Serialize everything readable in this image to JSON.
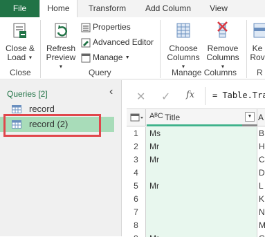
{
  "tabs": [
    {
      "label": "File"
    },
    {
      "label": "Home"
    },
    {
      "label": "Transform"
    },
    {
      "label": "Add Column"
    },
    {
      "label": "View"
    }
  ],
  "ribbon": {
    "close_load": {
      "line1": "Close &",
      "line2": "Load"
    },
    "refresh_preview": {
      "line1": "Refresh",
      "line2": "Preview"
    },
    "properties": "Properties",
    "advanced_editor": "Advanced Editor",
    "manage": "Manage",
    "choose_columns": {
      "line1": "Choose",
      "line2": "Columns"
    },
    "remove_columns": {
      "line1": "Remove",
      "line2": "Columns"
    },
    "keep_rows": {
      "line1": "Ke",
      "line2": "Rov"
    },
    "groups": {
      "close": "Close",
      "query": "Query",
      "manage_columns": "Manage Columns",
      "next": "R"
    }
  },
  "queries": {
    "header": "Queries [2]",
    "collapse_glyph": "‹",
    "items": [
      {
        "label": "record"
      },
      {
        "label": "record (2)"
      }
    ]
  },
  "formula_bar": {
    "cancel": "✕",
    "confirm": "✓",
    "fx": "fx",
    "formula": "= Table.Tran"
  },
  "grid": {
    "column_type": "AᴮC",
    "column_name": "Title",
    "second_column_name": "A",
    "rows": [
      {
        "num": "1",
        "title": "Ms",
        "next": "B"
      },
      {
        "num": "2",
        "title": "Mr",
        "next": "H"
      },
      {
        "num": "3",
        "title": "Mr",
        "next": "C"
      },
      {
        "num": "4",
        "title": "",
        "next": "D"
      },
      {
        "num": "5",
        "title": "Mr",
        "next": "L"
      },
      {
        "num": "6",
        "title": "",
        "next": "K"
      },
      {
        "num": "7",
        "title": "",
        "next": "N"
      },
      {
        "num": "8",
        "title": "",
        "next": "M"
      },
      {
        "num": "9",
        "title": "Mr",
        "next": "C"
      }
    ]
  },
  "colors": {
    "accent": "#217346",
    "selected": "#a8dcb9",
    "highlight_box": "#e0474c"
  }
}
